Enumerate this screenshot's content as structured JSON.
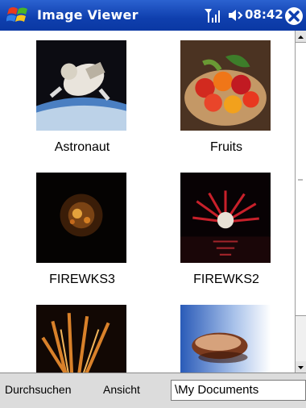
{
  "titlebar": {
    "title": "Image Viewer",
    "clock": "08:42"
  },
  "gallery": {
    "items": [
      {
        "label": "Astronaut"
      },
      {
        "label": "Fruits"
      },
      {
        "label": "FIREWKS3"
      },
      {
        "label": "FIREWKS2"
      },
      {
        "label": ""
      },
      {
        "label": ""
      }
    ]
  },
  "menubar": {
    "browse": "Durchsuchen",
    "view": "Ansicht",
    "path": "\\My Documents"
  },
  "colors": {
    "titlebar": "#1a49bd",
    "menubar": "#dcdcdc"
  }
}
